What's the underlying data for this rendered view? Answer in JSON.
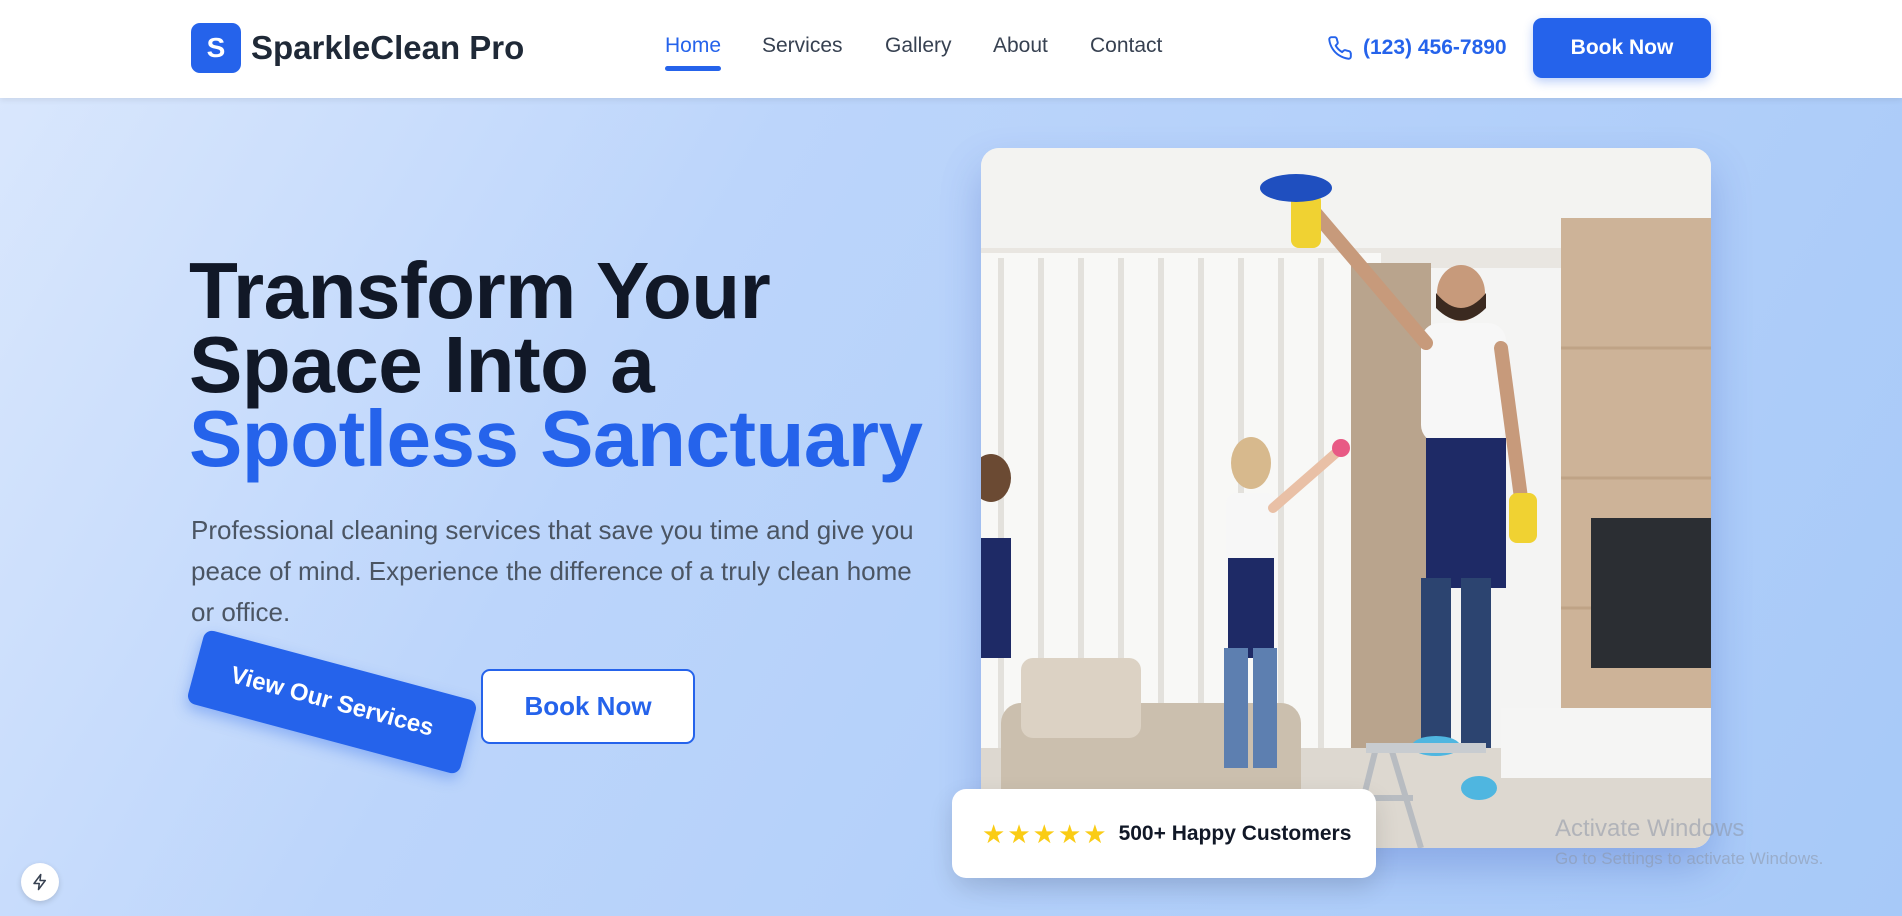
{
  "brand": {
    "logo_letter": "S",
    "name": "SparkleClean Pro",
    "accent": "#2563eb"
  },
  "nav": {
    "items": [
      {
        "label": "Home",
        "active": true
      },
      {
        "label": "Services"
      },
      {
        "label": "Gallery"
      },
      {
        "label": "About"
      },
      {
        "label": "Contact"
      }
    ]
  },
  "header": {
    "phone": "(123) 456-7890",
    "phone_icon": "phone-icon",
    "book_label": "Book Now"
  },
  "hero": {
    "title_line1": "Transform Your",
    "title_line2": "Space Into a",
    "title_accent": "Spotless Sanctuary",
    "description": "Professional cleaning services that save you time and give you peace of mind. Experience the difference of a truly clean home or office.",
    "primary_button": "View Our Services",
    "secondary_button": "Book Now"
  },
  "badge": {
    "stars": 5,
    "text": "500+ Happy Customers",
    "star_color": "#facc15"
  },
  "watermark": {
    "title": "Activate Windows",
    "subtitle": "Go to Settings to activate Windows."
  }
}
